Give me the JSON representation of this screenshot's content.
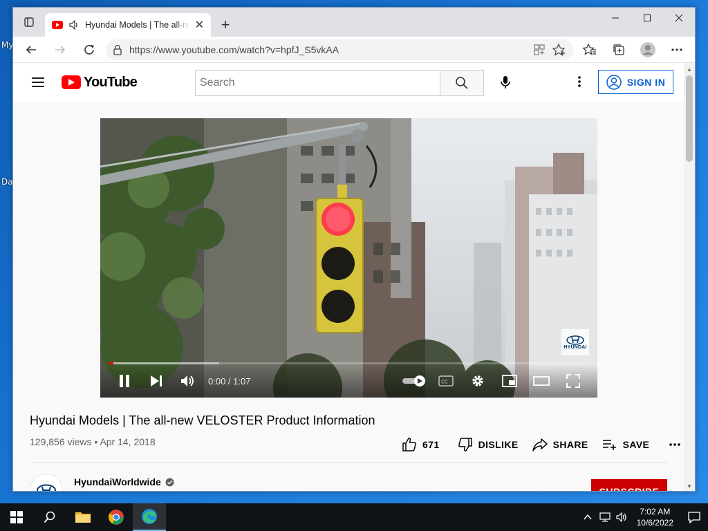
{
  "desktop": {
    "labels": [
      "My",
      "Da"
    ]
  },
  "browser": {
    "tab": {
      "title": "Hyundai Models | The all-new VELOSTER Product Information - YouTube",
      "favicon": "youtube-icon",
      "audio_icon": "speaker-icon"
    },
    "new_tab": "+",
    "address": {
      "url": "https://www.youtube.com/watch?v=hpfJ_S5vkAA"
    }
  },
  "youtube": {
    "logo_text": "YouTube",
    "search": {
      "placeholder": "Search",
      "value": ""
    },
    "sign_in": "SIGN IN"
  },
  "video": {
    "time": "0:00 / 1:07",
    "played_fraction": 0.01,
    "buffered_fraction": 0.23,
    "watermark": "HYUNDAI"
  },
  "details": {
    "title": "Hyundai Models | The all-new VELOSTER Product Information",
    "views": "129,856 views",
    "separator": "•",
    "date": "Apr 14, 2018",
    "likes": "671",
    "dislike": "DISLIKE",
    "share": "SHARE",
    "save": "SAVE"
  },
  "channel": {
    "name": "HyundaiWorldwide",
    "subscribe": "SUBSCRIBE"
  },
  "taskbar": {
    "time": "7:02 AM",
    "date": "10/6/2022"
  },
  "colors": {
    "youtube_red": "#ff0000",
    "link_blue": "#065fd4",
    "subscribe_red": "#cc0000"
  }
}
